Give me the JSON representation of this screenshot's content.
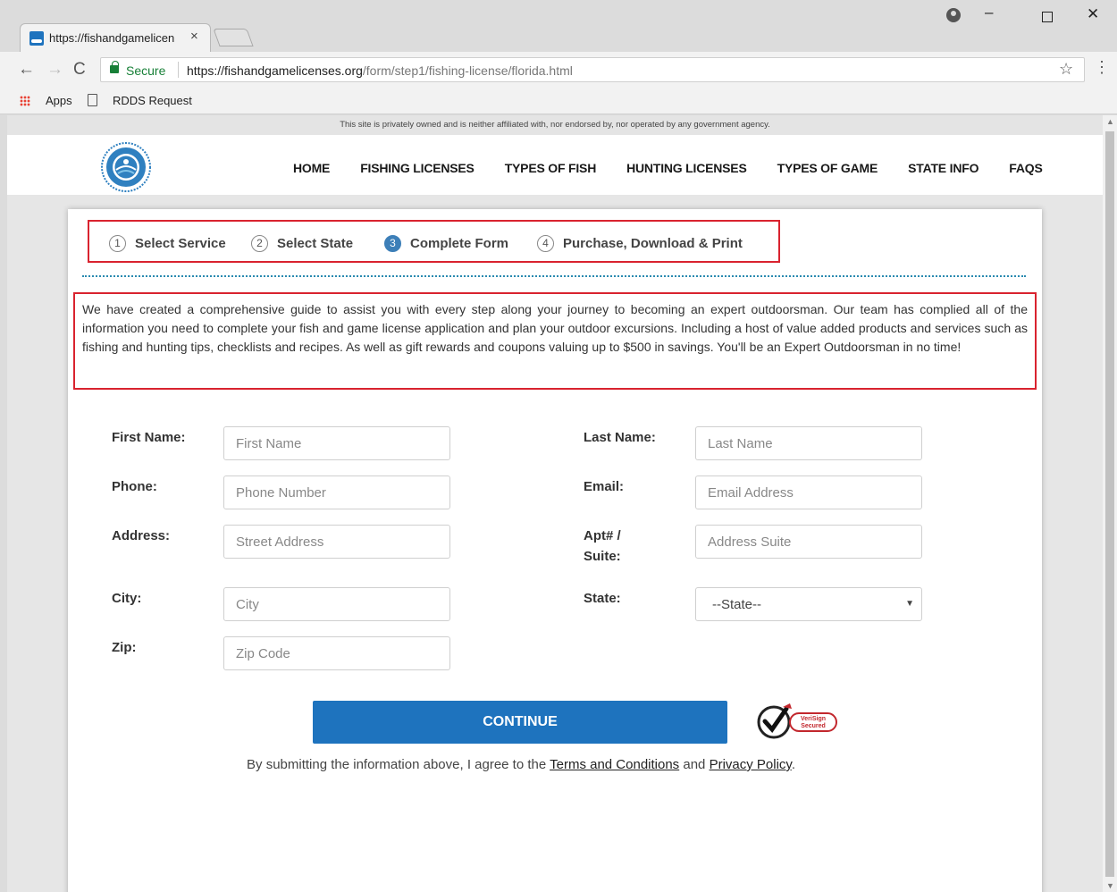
{
  "browser": {
    "tab_title": "https://fishandgamelicen",
    "tab_close": "×",
    "secure_label": "Secure",
    "url_host": "https://fishandgamelicenses.org",
    "url_path": "/form/step1/fishing-license/florida.html",
    "bookmarks": [
      "Apps",
      "RDDS Request"
    ]
  },
  "site": {
    "notice": "This site is privately owned and is neither affiliated with, nor endorsed by, nor operated by any government agency.",
    "nav": [
      "HOME",
      "FISHING LICENSES",
      "TYPES OF FISH",
      "HUNTING LICENSES",
      "TYPES OF GAME",
      "STATE INFO",
      "FAQS"
    ]
  },
  "steps": [
    {
      "num": "1",
      "label": "Select Service"
    },
    {
      "num": "2",
      "label": "Select State"
    },
    {
      "num": "3",
      "label": "Complete Form"
    },
    {
      "num": "4",
      "label": "Purchase, Download & Print"
    }
  ],
  "intro": "We have created a comprehensive guide to assist you with every step along your journey to becoming an expert outdoorsman. Our team has complied all of the information you need to complete your fish and game license application and plan your outdoor excursions. Including a host of value added products and services such as fishing and hunting tips, checklists and recipes. As well as gift rewards and coupons valuing up to $500 in savings. You'll be an Expert Outdoorsman in no time!",
  "form": {
    "first_name": {
      "label": "First Name:",
      "placeholder": "First Name"
    },
    "last_name": {
      "label": "Last Name:",
      "placeholder": "Last Name"
    },
    "phone": {
      "label": "Phone:",
      "placeholder": "Phone Number"
    },
    "email": {
      "label": "Email:",
      "placeholder": "Email Address"
    },
    "address": {
      "label": "Address:",
      "placeholder": "Street Address"
    },
    "suite": {
      "label_line1": "Apt# /",
      "label_line2": "Suite:",
      "placeholder": "Address Suite"
    },
    "city": {
      "label": "City:",
      "placeholder": "City"
    },
    "state": {
      "label": "State:",
      "value": "--State--"
    },
    "zip": {
      "label": "Zip:",
      "placeholder": "Zip Code"
    },
    "continue_label": "CONTINUE",
    "verisign_text": "VeriSign Secured",
    "terms_prefix": "By submitting the information above, I agree to the ",
    "terms_link": "Terms and Conditions",
    "terms_and": " and ",
    "privacy_link": "Privacy Policy",
    "terms_suffix": "."
  },
  "colors": {
    "primary_blue": "#1e73be",
    "highlight_red": "#d9232f",
    "step_active": "#3d7fb8"
  }
}
